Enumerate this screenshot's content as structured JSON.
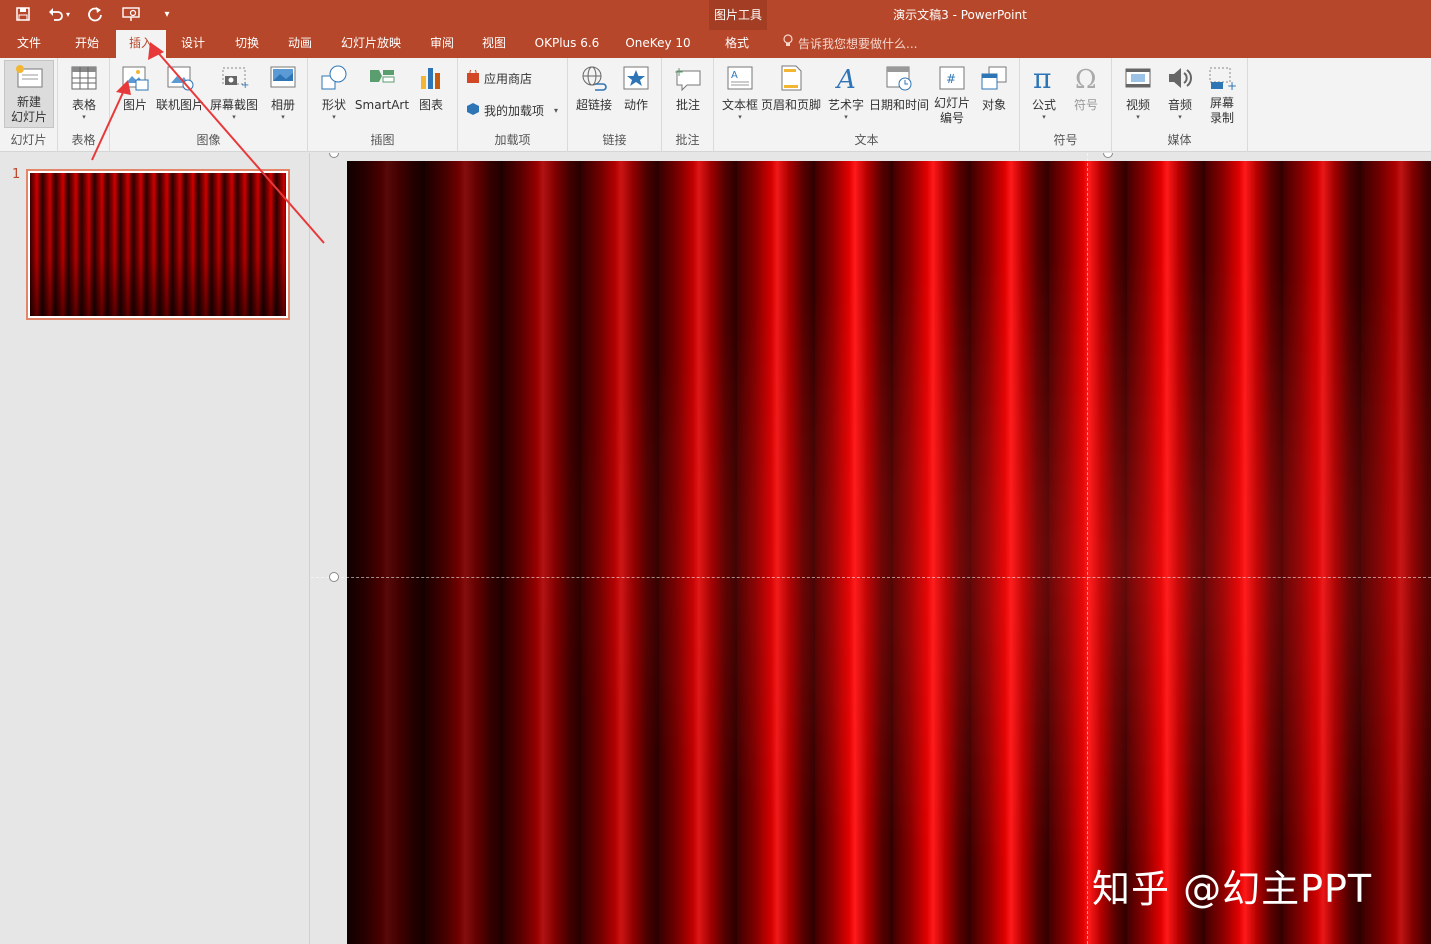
{
  "titlebar": {
    "doc_title": "演示文稿3 - PowerPoint",
    "context_group": "图片工具"
  },
  "tabs": [
    {
      "label": "文件"
    },
    {
      "label": "开始"
    },
    {
      "label": "插入"
    },
    {
      "label": "设计"
    },
    {
      "label": "切换"
    },
    {
      "label": "动画"
    },
    {
      "label": "幻灯片放映"
    },
    {
      "label": "审阅"
    },
    {
      "label": "视图"
    },
    {
      "label": "OKPlus 6.6"
    },
    {
      "label": "OneKey 10"
    },
    {
      "label": "格式"
    }
  ],
  "tell_me": "告诉我您想要做什么...",
  "ribbon": {
    "slides": {
      "new_slide": "新建\n幻灯片",
      "label": "幻灯片"
    },
    "tables": {
      "table": "表格",
      "label": "表格"
    },
    "images": {
      "picture": "图片",
      "online_picture": "联机图片",
      "screenshot": "屏幕截图",
      "album": "相册",
      "label": "图像"
    },
    "illustrations": {
      "shapes": "形状",
      "smartart": "SmartArt",
      "chart": "图表",
      "label": "插图"
    },
    "addins": {
      "store": "应用商店",
      "my_addins": "我的加载项",
      "label": "加载项"
    },
    "links": {
      "hyperlink": "超链接",
      "action": "动作",
      "label": "链接"
    },
    "comments": {
      "comment": "批注",
      "label": "批注"
    },
    "text": {
      "textbox": "文本框",
      "header_footer": "页眉和页脚",
      "wordart": "艺术字",
      "datetime": "日期和时间",
      "slide_number": "幻灯片\n编号",
      "object": "对象",
      "label": "文本"
    },
    "symbols": {
      "equation": "公式",
      "symbol": "符号",
      "label": "符号"
    },
    "media": {
      "video": "视频",
      "audio": "音频",
      "screen_record": "屏幕\n录制",
      "label": "媒体"
    }
  },
  "slides_pane": {
    "slide_number": "1"
  },
  "watermark": "知乎 @幻主PPT",
  "colors": {
    "accent": "#b7472a",
    "curtain": "#d40000"
  }
}
